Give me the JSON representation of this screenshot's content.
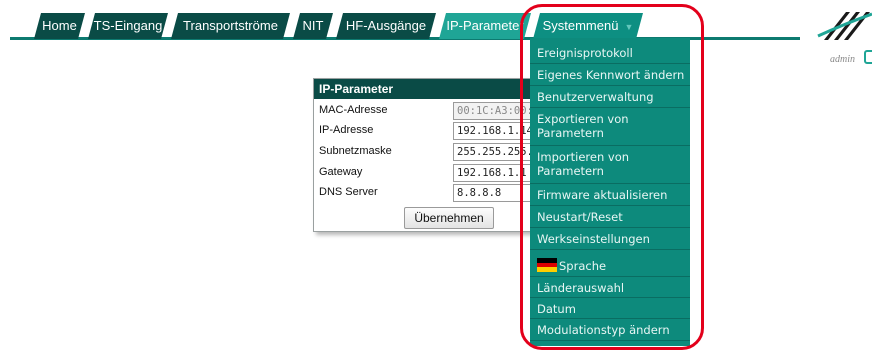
{
  "tabs": [
    {
      "label": "Home"
    },
    {
      "label": "TS-Eingang"
    },
    {
      "label": "Transportströme"
    },
    {
      "label": "NIT"
    },
    {
      "label": "HF-Ausgänge"
    },
    {
      "label": "IP-Parameter"
    },
    {
      "label": "Systemmenü"
    }
  ],
  "user": {
    "name": "admin"
  },
  "ip_panel": {
    "title": "IP-Parameter",
    "rows": [
      {
        "label": "MAC-Adresse",
        "value": "00:1C:A3:00:0"
      },
      {
        "label": "IP-Adresse",
        "value": "192.168.1.14"
      },
      {
        "label": "Subnetzmaske",
        "value": "255.255.255."
      },
      {
        "label": "Gateway",
        "value": "192.168.1.1"
      },
      {
        "label": "DNS Server",
        "value": "8.8.8.8"
      }
    ],
    "apply_label": "Übernehmen"
  },
  "system_menu": {
    "items": [
      {
        "label": "Ereignisprotokoll"
      },
      {
        "label": "Eigenes Kennwort ändern"
      },
      {
        "label": "Benutzerverwaltung"
      },
      {
        "label": "Exportieren von Parametern"
      },
      {
        "label": "Importieren von Parametern"
      },
      {
        "label": "Firmware aktualisieren"
      },
      {
        "label": "Neustart/Reset"
      },
      {
        "label": "Werkseinstellungen"
      },
      {
        "label": "Sprache"
      },
      {
        "label": "Länderauswahl"
      },
      {
        "label": "Datum"
      },
      {
        "label": "Modulationstyp ändern"
      }
    ]
  },
  "colors": {
    "tab_dark": "#0a4b46",
    "tab_active": "#1fa596",
    "menu_bg": "#0d8a7c",
    "highlight": "#e3001b"
  }
}
